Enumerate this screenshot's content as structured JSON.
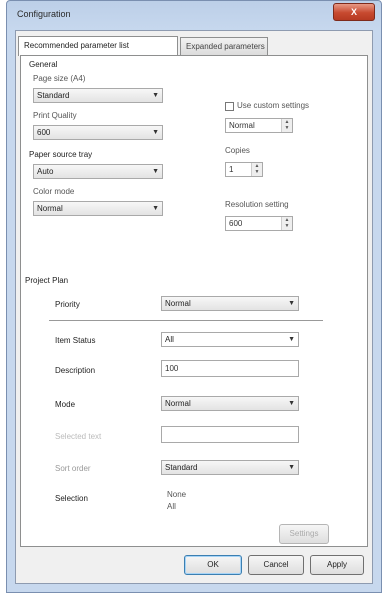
{
  "window": {
    "title": "Configuration",
    "close_label": "X"
  },
  "tabs": [
    {
      "label": "Recommended parameter list"
    },
    {
      "label": "Expanded parameters"
    }
  ],
  "general": {
    "section_label": "General",
    "page_size": {
      "label": "Page size (A4)",
      "value": "Standard"
    },
    "print_quality": {
      "label": "Print Quality",
      "value": "600"
    },
    "paper_source": {
      "label": "Paper source tray",
      "value": "Auto"
    },
    "color_mode": {
      "label": "Color mode",
      "value": "Normal"
    },
    "custom_checkbox_label": "Use custom settings",
    "custom_value": "Normal",
    "copies": {
      "label": "Copies",
      "value": "1"
    },
    "resolution": {
      "label": "Resolution setting",
      "value": "600"
    }
  },
  "project": {
    "section_label": "Project Plan",
    "priority": {
      "label": "Priority",
      "value": "Normal"
    },
    "item_status": {
      "label": "Item Status",
      "value": "All"
    },
    "description": {
      "label": "Description",
      "value": "100"
    },
    "mode": {
      "label": "Mode",
      "value": "Normal"
    },
    "disabled_field": {
      "label": "Selected text",
      "value": ""
    },
    "sort_field": {
      "label": "Sort order",
      "value": "Standard"
    },
    "selection": {
      "label": "Selection",
      "value_line1": "None",
      "value_line2": "All"
    },
    "settings_button": "Settings"
  },
  "footer": {
    "ok": "OK",
    "cancel": "Cancel",
    "apply": "Apply"
  }
}
